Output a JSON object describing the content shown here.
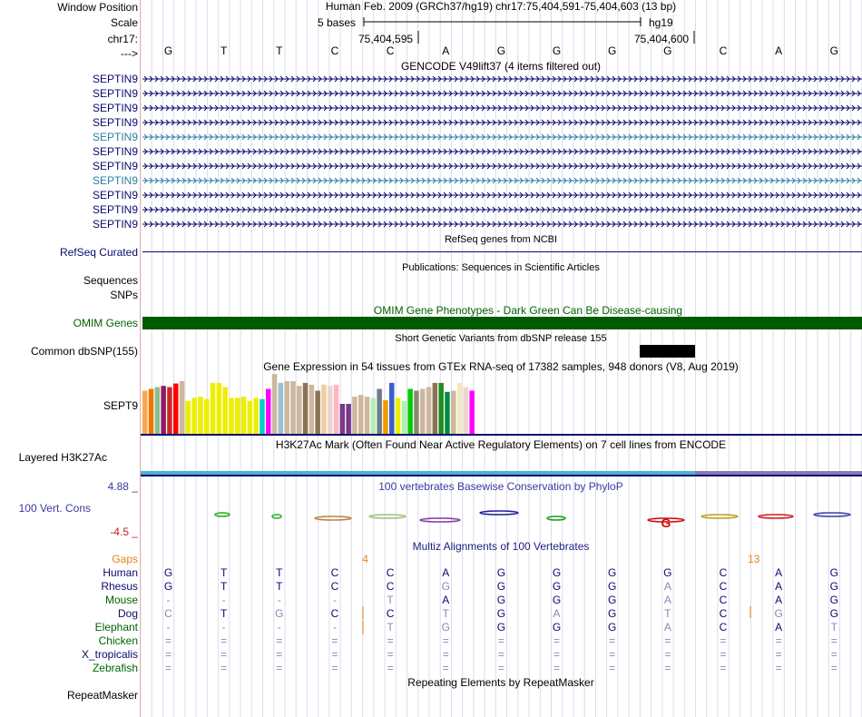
{
  "header": {
    "window_position_label": "Window Position",
    "scale_label": "Scale",
    "chrom_label": "chr17:",
    "arrow_label": "--->",
    "assembly_title": "Human Feb. 2009 (GRCh37/hg19)   chr17:75,404,591-75,404,603 (13 bp)",
    "scale_text": "5 bases",
    "scale_db": "hg19",
    "coord_left": "75,404,595",
    "coord_right": "75,404,600"
  },
  "bases": [
    "G",
    "T",
    "T",
    "C",
    "C",
    "A",
    "G",
    "G",
    "G",
    "G",
    "C",
    "A",
    "G"
  ],
  "gencode": {
    "title": "GENCODE V49lift37 (4 items filtered out)",
    "items": [
      {
        "label": "SEPTIN9",
        "color": "#0a0a6e"
      },
      {
        "label": "SEPTIN9",
        "color": "#0a0a6e"
      },
      {
        "label": "SEPTIN9",
        "color": "#0a0a6e"
      },
      {
        "label": "SEPTIN9",
        "color": "#0a0a6e"
      },
      {
        "label": "SEPTIN9",
        "color": "#2a7fa4"
      },
      {
        "label": "SEPTIN9",
        "color": "#0a0a6e"
      },
      {
        "label": "SEPTIN9",
        "color": "#0a0a6e"
      },
      {
        "label": "SEPTIN9",
        "color": "#2a7fa4"
      },
      {
        "label": "SEPTIN9",
        "color": "#0a0a6e"
      },
      {
        "label": "SEPTIN9",
        "color": "#0a0a6e"
      },
      {
        "label": "SEPTIN9",
        "color": "#0a0a6e"
      }
    ]
  },
  "refseq": {
    "title": "RefSeq genes from NCBI",
    "label": "RefSeq Curated"
  },
  "publications": {
    "title": "Publications: Sequences in Scientific Articles",
    "label1": "Sequences",
    "label2": "SNPs"
  },
  "omim": {
    "title": "OMIM Gene Phenotypes - Dark Green Can Be Disease-causing",
    "label": "OMIM Genes",
    "color": "#005a00"
  },
  "dbsnp": {
    "title": "Short Genetic Variants from dbSNP release 155",
    "label": "Common dbSNP(155)"
  },
  "gtex": {
    "title": "Gene Expression in 54 tissues from GTEx RNA-seq of 17382 samples, 948 donors (V8, Aug 2019)",
    "label": "SEPT9",
    "values": [
      0.72,
      0.75,
      0.78,
      0.8,
      0.78,
      0.84,
      0.88,
      0.55,
      0.6,
      0.62,
      0.58,
      0.85,
      0.85,
      0.78,
      0.6,
      0.6,
      0.62,
      0.55,
      0.6,
      0.58,
      0.75,
      1.0,
      0.85,
      0.88,
      0.88,
      0.8,
      0.85,
      0.82,
      0.72,
      0.82,
      0.8,
      0.82,
      0.5,
      0.5,
      0.62,
      0.65,
      0.62,
      0.6,
      0.75,
      0.56,
      0.85,
      0.6,
      0.55,
      0.75,
      0.72,
      0.75,
      0.78,
      0.85,
      0.85,
      0.7,
      0.72,
      0.85,
      0.78,
      0.72
    ],
    "colors": [
      "#ffa54f",
      "#ee7600",
      "#8fbc8f",
      "#8b1c62",
      "#cd2626",
      "#ff0000",
      "#cdb79e",
      "#eeee00",
      "#eeee00",
      "#eeee00",
      "#eeee00",
      "#eeee00",
      "#eeee00",
      "#eeee00",
      "#eeee00",
      "#eeee00",
      "#eeee00",
      "#eeee00",
      "#eeee00",
      "#00ced1",
      "#ff00ff",
      "#cdb79e",
      "#9ac0cd",
      "#cdb79e",
      "#cdb79e",
      "#cdb79e",
      "#8b7355",
      "#cdb79e",
      "#8b7355",
      "#eecfa1",
      "#eed5d2",
      "#ffb6c1",
      "#7a378b",
      "#7a378b",
      "#cdb79e",
      "#cdb79e",
      "#cdb79e",
      "#b4eeb4",
      "#6e7b8b",
      "#ee9a00",
      "#3a5fcd",
      "#eeee00",
      "#b4eeb4",
      "#00cd00",
      "#8b8970",
      "#cdb79e",
      "#cdb79e",
      "#8b7355",
      "#228b22",
      "#008b45",
      "#cdb79e",
      "#eee9bf",
      "#eed5d2",
      "#ff00ff"
    ]
  },
  "h3k27ac": {
    "title": "H3K27Ac Mark (Often Found Near Active Regulatory Elements) on 7 cell lines from ENCODE",
    "label": "Layered H3K27Ac"
  },
  "phylop": {
    "title": "100 vertebrates Basewise Conservation by PhyloP",
    "label": "100 Vert. Cons",
    "max": "4.88 _",
    "min": "-4.5 _"
  },
  "multiz": {
    "title": "Multiz Alignments of 100 Vertebrates",
    "gaps_label": "Gaps",
    "gap_marks": [
      {
        "text": "4",
        "base_index": 3.55
      },
      {
        "text": "13",
        "base_index": 10.55
      }
    ],
    "species": [
      {
        "name": "Human",
        "color": "#0a0a6e",
        "seq": [
          "G",
          "T",
          "T",
          "C",
          "C",
          "A",
          "G",
          "G",
          "G",
          "G",
          "C",
          "A",
          "G"
        ]
      },
      {
        "name": "Rhesus",
        "color": "#0a0a6e",
        "seq": [
          "G",
          "T",
          "T",
          "C",
          "C",
          "G",
          "G",
          "G",
          "G",
          "A",
          "C",
          "A",
          "G"
        ]
      },
      {
        "name": "Mouse",
        "color": "#006400",
        "seq": [
          "-",
          "-",
          "-",
          "-",
          "T",
          "A",
          "G",
          "G",
          "G",
          "A",
          "C",
          "A",
          "G"
        ]
      },
      {
        "name": "Dog",
        "color": "#0a0a6e",
        "seq": [
          "C",
          "T",
          "G",
          "C",
          "C",
          "T",
          "G",
          "A",
          "G",
          "T",
          "C",
          "G",
          "G"
        ]
      },
      {
        "name": "Elephant",
        "color": "#006400",
        "seq": [
          "-",
          "-",
          "-",
          "-",
          "T",
          "G",
          "G",
          "G",
          "G",
          "A",
          "C",
          "A",
          "T"
        ]
      },
      {
        "name": "Chicken",
        "color": "#006400",
        "seq": [
          "=",
          "=",
          "=",
          "=",
          "=",
          "=",
          "=",
          "=",
          "=",
          "=",
          "=",
          "=",
          "="
        ]
      },
      {
        "name": "X_tropicalis",
        "color": "#0a0a6e",
        "seq": [
          "=",
          "=",
          "=",
          "=",
          "=",
          "=",
          "=",
          "=",
          "=",
          "=",
          "=",
          "=",
          "="
        ]
      },
      {
        "name": "Zebrafish",
        "color": "#006400",
        "seq": [
          "=",
          "=",
          "=",
          "=",
          "=",
          "=",
          "=",
          "=",
          "=",
          "=",
          "=",
          "=",
          "="
        ]
      }
    ],
    "dim_cells": {
      "Rhesus": [
        5,
        9
      ],
      "Mouse": [
        0,
        1,
        2,
        3,
        4,
        9
      ],
      "Dog": [
        0,
        2,
        5,
        7,
        9,
        11
      ],
      "Elephant": [
        0,
        1,
        2,
        3,
        4,
        5,
        9,
        12
      ],
      "Chicken": "all",
      "X_tropicalis": "all",
      "Zebrafish": "all"
    }
  },
  "repeatmasker": {
    "title": "Repeating Elements by RepeatMasker",
    "label": "RepeatMasker"
  }
}
